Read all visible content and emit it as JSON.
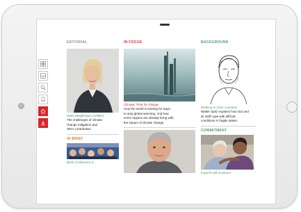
{
  "magazine": {
    "editorial": {
      "section_label": "EDITORIAL",
      "caption": "Hans Wegelmann COMDS",
      "text": [
        "The challenges of climate",
        "change mitigation and",
        "SEI's contribution"
      ],
      "secondary_label": "IN BRIEF",
      "bottom_caption": "Bonn Conference a"
    },
    "in_focus": {
      "section_label": "IN FOCUS",
      "caption": "Climate: Time for change",
      "text": [
        "How the world is training for ways",
        "to stop global warming. And how",
        "some regions are already living with",
        "the impact of climate change"
      ]
    },
    "background": {
      "section_label": "BACKGROUND",
      "caption": "Working in crisis countries",
      "text": [
        "Walter Spitz explains how GIZ and",
        "its staff cope with difficult",
        "conditions in fragile states."
      ],
      "secondary_label": "COMMITMENT",
      "bottom_caption": "Experts with business"
    },
    "sidebar_icons": [
      "grid-icon",
      "layout-icon",
      "search-icon",
      "bookmark-icon",
      "home-icon",
      "share-icon"
    ]
  },
  "colors": {
    "accent_red": "#d9232a",
    "accent_green": "#4f9a6c",
    "accent_teal": "#3a8a8c",
    "accent_orange": "#e07a2a"
  }
}
